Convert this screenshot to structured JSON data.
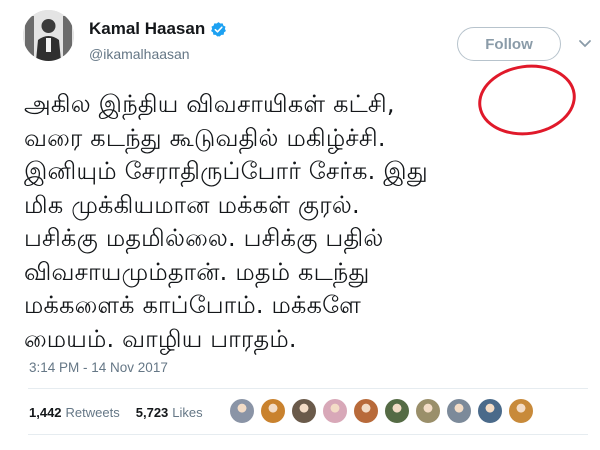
{
  "user": {
    "name": "Kamal Haasan",
    "handle": "@ikamalhaasan"
  },
  "follow_label": "Follow",
  "tweet": {
    "lines": [
      "அகில இந்திய  விவசாயிகள் கட்சி,",
      "வரை கடந்து கூடுவதில் மகிழ்ச்சி.",
      "இனியும் சேராதிருப்போர்  சேர்க. இது",
      "மிக முக்கியமான மக்கள் குரல்.",
      "பசிக்கு மதமில்லை. பசிக்கு பதில்",
      "விவசாயமும்தான். மதம் கடந்து",
      "மக்களைக் காப்போம். மக்களே",
      "மையம். வாழிய பாரதம்."
    ]
  },
  "timestamp": "3:14 PM - 14 Nov 2017",
  "stats": {
    "retweets_count": "1,442",
    "retweets_label": "Retweets",
    "likes_count": "5,723",
    "likes_label": "Likes"
  },
  "colors": {
    "verified_badge": "#1da1f2",
    "annotation_circle": "#e0192a",
    "follow_text": "#8a9ba8"
  },
  "likers": [
    {
      "icon": "liker-avatar",
      "color": "#8a94a6"
    },
    {
      "icon": "liker-avatar",
      "color": "#c9822e"
    },
    {
      "icon": "liker-avatar",
      "color": "#6a5a4a"
    },
    {
      "icon": "liker-avatar",
      "color": "#d8a8b8"
    },
    {
      "icon": "liker-avatar",
      "color": "#b86a3a"
    },
    {
      "icon": "liker-avatar",
      "color": "#556b45"
    },
    {
      "icon": "liker-avatar",
      "color": "#9a8f6a"
    },
    {
      "icon": "liker-avatar",
      "color": "#7c8a9a"
    },
    {
      "icon": "liker-avatar",
      "color": "#4a6a8a"
    },
    {
      "icon": "liker-avatar",
      "color": "#c88a3a"
    }
  ]
}
